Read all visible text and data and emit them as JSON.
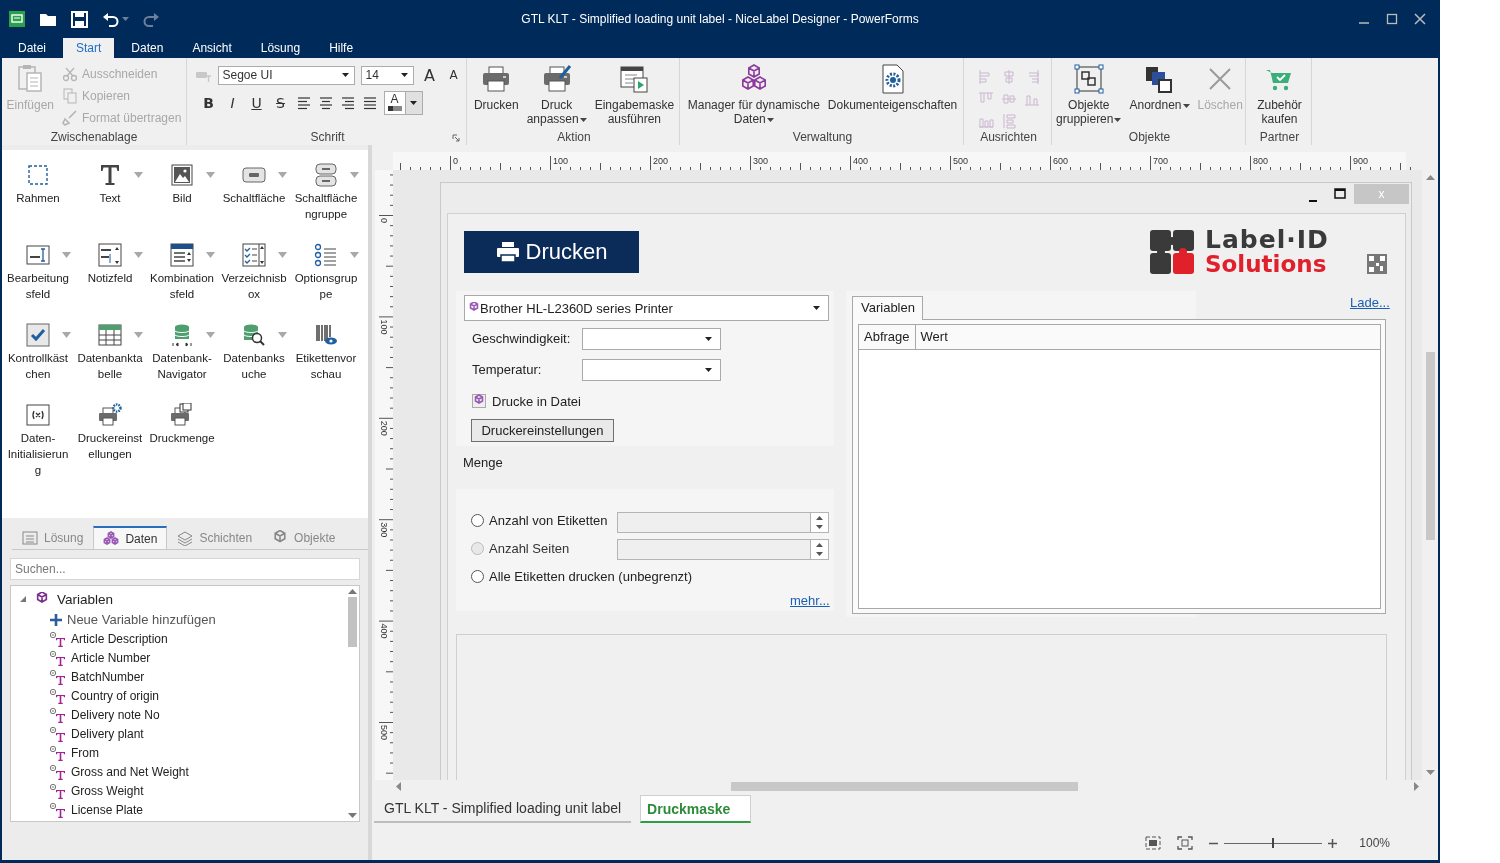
{
  "title_bar": {
    "title": "GTL KLT - Simplified loading unit label - NiceLabel Designer - PowerForms"
  },
  "menu_tabs": [
    {
      "label": "Datei",
      "selected": false
    },
    {
      "label": "Start",
      "selected": true
    },
    {
      "label": "Daten",
      "selected": false
    },
    {
      "label": "Ansicht",
      "selected": false
    },
    {
      "label": "Lösung",
      "selected": false
    },
    {
      "label": "Hilfe",
      "selected": false
    }
  ],
  "ribbon": {
    "groups": [
      {
        "label": "Zwischenablage",
        "kind": "clipboard",
        "items": [
          {
            "label": "Einfügen",
            "kind": "large",
            "disabled": true
          },
          {
            "label": "Ausschneiden",
            "kind": "small",
            "disabled": true
          },
          {
            "label": "Kopieren",
            "kind": "small",
            "disabled": true
          },
          {
            "label": "Format übertragen",
            "kind": "small",
            "disabled": true
          }
        ]
      },
      {
        "label": "Schrift",
        "kind": "font",
        "font_name": "Segoe UI",
        "font_size": "14",
        "grow_font": "A",
        "shrink_font": "A",
        "styles": [
          "B",
          "I",
          "U",
          "S"
        ],
        "font_color": "A"
      },
      {
        "label": "Aktion",
        "kind": "buttons",
        "items": [
          {
            "label": "Drucken",
            "dropdown": false,
            "disabled": false
          },
          {
            "label": "Druck\nanpassen",
            "dropdown": true,
            "disabled": false
          },
          {
            "label": "Eingabemaske\nausführen",
            "dropdown": false,
            "disabled": false
          }
        ]
      },
      {
        "label": "Verwaltung",
        "kind": "buttons",
        "items": [
          {
            "label": "Manager für dynamische\nDaten",
            "dropdown": true,
            "disabled": false
          },
          {
            "label": "Dokumenteigenschaften",
            "dropdown": false,
            "disabled": false
          }
        ]
      },
      {
        "label": "Ausrichten",
        "kind": "align",
        "items": [
          {
            "disabled": true
          },
          {
            "disabled": true
          },
          {
            "disabled": true
          },
          {
            "disabled": true
          },
          {
            "disabled": true
          },
          {
            "disabled": true
          },
          {
            "disabled": true
          },
          {
            "disabled": true
          }
        ]
      },
      {
        "label": "Objekte",
        "kind": "buttons",
        "items": [
          {
            "label": "Objekte\ngruppieren",
            "dropdown": true,
            "disabled": false
          },
          {
            "label": "Anordnen",
            "dropdown": true,
            "disabled": false
          },
          {
            "label": "Löschen",
            "dropdown": false,
            "disabled": true
          }
        ]
      },
      {
        "label": "Partner",
        "kind": "buttons",
        "items": [
          {
            "label": "Zubehör\nkaufen",
            "dropdown": false,
            "disabled": false
          }
        ]
      }
    ]
  },
  "toolbox": {
    "items": [
      {
        "label": "Rahmen",
        "dropdown": false
      },
      {
        "label": "Text",
        "dropdown": true
      },
      {
        "label": "Bild",
        "dropdown": true
      },
      {
        "label": "Schaltfläche",
        "dropdown": true
      },
      {
        "label": "Schaltfläche\nngruppe",
        "dropdown": true
      },
      {
        "label": "Bearbeitung\nsfeld",
        "dropdown": true
      },
      {
        "label": "Notizfeld",
        "dropdown": true
      },
      {
        "label": "Kombination\nsfeld",
        "dropdown": true
      },
      {
        "label": "Verzeichnisb\nox",
        "dropdown": true
      },
      {
        "label": "Optionsgrup\npe",
        "dropdown": true
      },
      {
        "label": "Kontrollkäst\nchen",
        "dropdown": true
      },
      {
        "label": "Datenbankta\nbelle",
        "dropdown": true
      },
      {
        "label": "Datenbank-\nNavigator",
        "dropdown": true
      },
      {
        "label": "Datenbanks\nuche",
        "dropdown": true
      },
      {
        "label": "Etikettenvor\nschau",
        "dropdown": false
      },
      {
        "label": "Daten-\nInitialisierun\ng",
        "dropdown": false
      },
      {
        "label": "Druckereinst\nellungen",
        "dropdown": false
      },
      {
        "label": "Druckmenge",
        "dropdown": false
      }
    ]
  },
  "side_panel": {
    "tabs": [
      {
        "label": "Lösung",
        "selected": false
      },
      {
        "label": "Daten",
        "selected": true
      },
      {
        "label": "Schichten",
        "selected": false
      },
      {
        "label": "Objekte",
        "selected": false
      }
    ],
    "search": {
      "placeholder": "Suchen..."
    },
    "tree": [
      {
        "label": "Variablen",
        "expanded": true,
        "children": [
          {
            "label": "Neue Variable hinzufügen",
            "kind": "add"
          },
          {
            "label": "Article Description",
            "kind": "variable"
          },
          {
            "label": "Article Number",
            "kind": "variable"
          },
          {
            "label": "BatchNumber",
            "kind": "variable"
          },
          {
            "label": "Country of origin",
            "kind": "variable"
          },
          {
            "label": "Delivery note No",
            "kind": "variable"
          },
          {
            "label": "Delivery plant",
            "kind": "variable"
          },
          {
            "label": "From",
            "kind": "variable"
          },
          {
            "label": "Gross and Net Weight",
            "kind": "variable"
          },
          {
            "label": "Gross Weight",
            "kind": "variable"
          },
          {
            "label": "License Plate",
            "kind": "variable"
          }
        ]
      }
    ]
  },
  "rulers": {
    "horizontal": [
      "0",
      "100",
      "200",
      "300",
      "400",
      "500",
      "600",
      "700",
      "800",
      "900"
    ],
    "vertical": [
      "0",
      "100",
      "200",
      "300",
      "400",
      "500"
    ]
  },
  "form": {
    "close_label": "x",
    "print_button": "Drucken",
    "logo": {
      "title": "Label·ID",
      "subtitle": "Solutions"
    },
    "printer": {
      "value": "Brother HL-L2360D series Printer"
    },
    "fields": [
      {
        "label": "Geschwindigkeit:"
      },
      {
        "label": "Temperatur:"
      }
    ],
    "print_to_file": "Drucke in Datei",
    "settings_button": "Druckereinstellungen",
    "quantity_label": "Menge",
    "quantity_options": [
      {
        "label": "Anzahl von Etiketten",
        "kind": "spin",
        "selected": false,
        "disabled": false
      },
      {
        "label": "Anzahl Seiten",
        "kind": "spin",
        "selected": false,
        "disabled": true
      },
      {
        "label": "Alle Etiketten drucken (unbegrenzt)",
        "kind": "plain",
        "selected": false,
        "disabled": false
      }
    ],
    "more_link": "mehr...",
    "variables_tab": {
      "label": "Variablen",
      "selected": true
    },
    "load_link": "Lade...",
    "table": {
      "columns": [
        "Abfrage",
        "Wert"
      ]
    }
  },
  "doc_tabs": [
    {
      "label": "GTL KLT - Simplified loading unit label",
      "selected": false
    },
    {
      "label": "Druckmaske",
      "selected": true
    }
  ],
  "status_bar": {
    "zoom_slider": {
      "level": 0.5
    },
    "zoom_label": "100%"
  }
}
